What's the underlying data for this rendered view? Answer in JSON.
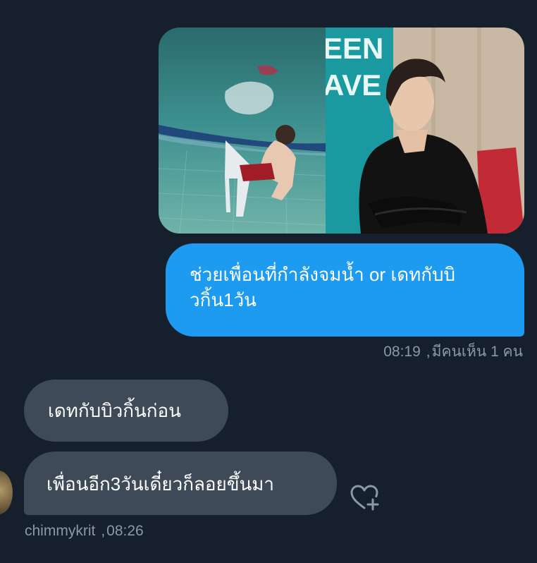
{
  "sent": {
    "media_alt": "two-panel photo: chair underwater in a pool and a man in a black shirt",
    "media_partial_text": [
      "EEN",
      "AVE"
    ],
    "message": "ช่วยเพื่อนที่กำลังจมน้ำ or เดทกับบิวกิ้น1วัน",
    "time": "08:19",
    "seen": "มีคนเห็น 1 คน"
  },
  "received": {
    "messages": [
      "เดทกับบิวกิ้นก่อน",
      "เพื่อนอีก3วันเดี๋ยวก็ลอยขึ้นมา"
    ],
    "username": "chimmykrit",
    "time": "08:26"
  },
  "icons": {
    "react": "heart-plus-icon",
    "avatar": "user-avatar"
  },
  "colors": {
    "background": "#16202c",
    "sent_bubble": "#1d9bf0",
    "received_bubble": "#3e4a57",
    "meta_text": "#8b98a5"
  }
}
